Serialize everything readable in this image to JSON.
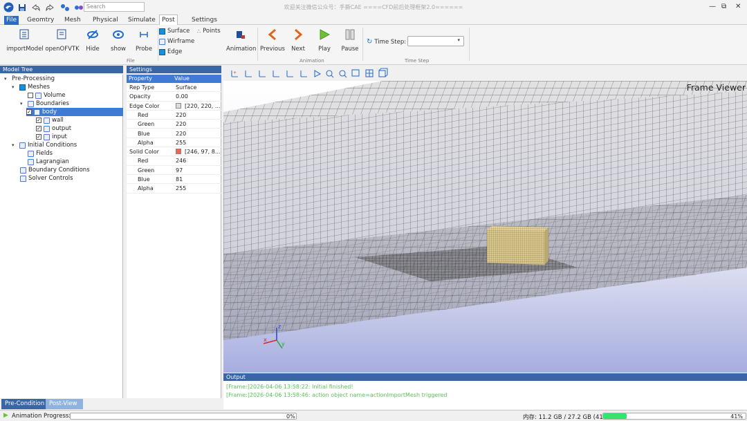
{
  "window": {
    "title": "欢迎关注微信公众号：手撕CAE ====CFD前后处理框架2.0======",
    "search_placeholder": "Search",
    "controls": [
      "—",
      "⧉",
      "✕"
    ]
  },
  "menu": [
    "File",
    "Geomtry",
    "Mesh",
    "Physical",
    "Simulate",
    "Post",
    "Settings"
  ],
  "ribbon": {
    "file_buttons": [
      "importModel",
      "openOFVTK",
      "Hide",
      "show",
      "Probe"
    ],
    "file_group": "File",
    "render_modes": [
      "Surface",
      "Points",
      "Wirframe",
      "Edge"
    ],
    "animation_button": "Animation",
    "animation_buttons": [
      "Previous",
      "Next",
      "Play",
      "Pause"
    ],
    "animation_group": "Animation",
    "time_step_label": "Time Step:",
    "time_step_group": "Time Step"
  },
  "model_tree": {
    "header": "Model Tree",
    "items": [
      "Pre-Processing",
      "Meshes",
      "Volume",
      "Boundaries",
      "body",
      "wall",
      "output",
      "input",
      "Initial Conditions",
      "Fields",
      "Lagrangian",
      "Boundary Conditions",
      "Solver Controls"
    ]
  },
  "settings": {
    "header": "Settings",
    "col_property": "Property",
    "col_value": "Value",
    "rows": [
      {
        "p": "Rep Type",
        "v": "Surface"
      },
      {
        "p": "Opacity",
        "v": "0.00"
      },
      {
        "p": "Edge Color",
        "v": "[220, 220, ..."
      },
      {
        "p": "Red",
        "v": "220"
      },
      {
        "p": "Green",
        "v": "220"
      },
      {
        "p": "Blue",
        "v": "220"
      },
      {
        "p": "Alpha",
        "v": "255"
      },
      {
        "p": "Solid Color",
        "v": "[246, 97, 8..."
      },
      {
        "p": "Red",
        "v": "246"
      },
      {
        "p": "Green",
        "v": "97"
      },
      {
        "p": "Blue",
        "v": "81"
      },
      {
        "p": "Alpha",
        "v": "255"
      }
    ],
    "edge_color": "#dcdcdc",
    "solid_color": "#f66151"
  },
  "tabs": [
    "Pre-Condition",
    "Post-View"
  ],
  "viewer": {
    "label": "Frame Viewer"
  },
  "output": {
    "header": "Output",
    "lines": [
      "[Frame:]2026-04-06 13:58:22: Initial finished!",
      "[Frame:]2026-04-06 13:58:46: action object name=actionImportMesh triggered"
    ]
  },
  "status": {
    "anim_label": "Animation Progress:",
    "anim_value": "0%",
    "anim_progress": 0,
    "mem_label": "内存: 11.2 GB / 27.2 GB (41%)",
    "mem_value": "41%",
    "mem_progress": 0.41
  }
}
